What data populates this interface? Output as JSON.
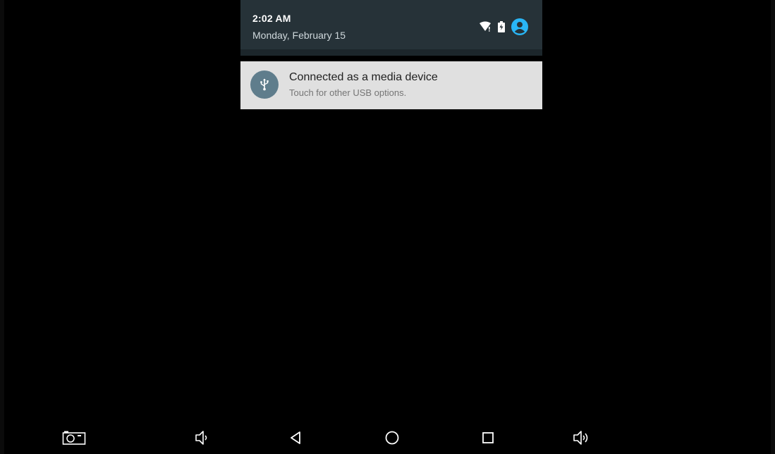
{
  "status_bar": {
    "time": "2:02 AM",
    "date": "Monday, February 15",
    "icons": [
      "wifi-icon",
      "battery-icon",
      "user-account-icon"
    ],
    "accent_color": "#29b6f6"
  },
  "notification": {
    "title": "Connected as a media device",
    "text": "Touch for other USB options.",
    "icon": "usb-icon",
    "icon_bg": "#5f7d8c"
  },
  "navigation_bar": {
    "buttons": [
      "screenshot-icon",
      "volume-down-icon",
      "back-icon",
      "home-icon",
      "recents-icon",
      "volume-up-icon"
    ]
  }
}
